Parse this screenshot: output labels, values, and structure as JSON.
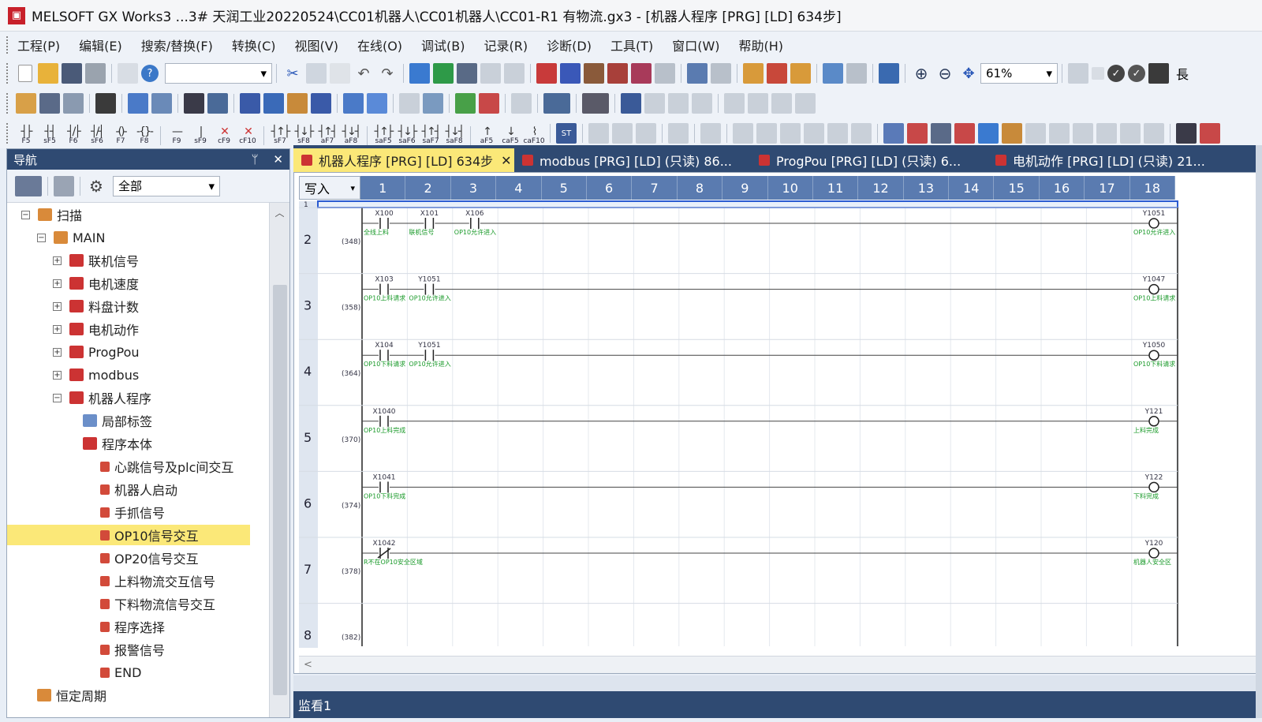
{
  "title": "MELSOFT GX Works3 ...3# 天润工业20220524\\CC01机器人\\CC01机器人\\CC01-R1 有物流.gx3 - [机器人程序 [PRG] [LD] 634步]",
  "menu": [
    "工程(P)",
    "编辑(E)",
    "搜索/替换(F)",
    "转换(C)",
    "视图(V)",
    "在线(O)",
    "调试(B)",
    "记录(R)",
    "诊断(D)",
    "工具(T)",
    "窗口(W)",
    "帮助(H)"
  ],
  "toolbar": {
    "zoom": "61%",
    "last_char": "長"
  },
  "fkeys": [
    {
      "sym": "┤├",
      "label": "F5"
    },
    {
      "sym": "┤┤",
      "label": "sF5"
    },
    {
      "sym": "┤/├",
      "label": "F6"
    },
    {
      "sym": "┤/┤",
      "label": "sF6"
    },
    {
      "sym": "-()-",
      "label": "F7"
    },
    {
      "sym": "-{}-",
      "label": "F8"
    },
    {
      "sym": "—",
      "label": "F9"
    },
    {
      "sym": "|",
      "label": "sF9"
    },
    {
      "sym": "✕",
      "label": "cF9"
    },
    {
      "sym": "✕",
      "label": "cF10"
    },
    {
      "sym": "┤↑├",
      "label": "sF7"
    },
    {
      "sym": "┤↓├",
      "label": "sF8"
    },
    {
      "sym": "┤↑┤",
      "label": "aF7"
    },
    {
      "sym": "┤↓┤",
      "label": "aF8"
    },
    {
      "sym": "┤↑├",
      "label": "saF5"
    },
    {
      "sym": "┤↓├",
      "label": "saF6"
    },
    {
      "sym": "┤↑┤",
      "label": "saF7"
    },
    {
      "sym": "┤↓┤",
      "label": "saF8"
    },
    {
      "sym": "↑",
      "label": "aF5"
    },
    {
      "sym": "↓",
      "label": "caF5"
    },
    {
      "sym": "⌇",
      "label": "caF10"
    }
  ],
  "nav": {
    "title": "导航",
    "pin": "ᛘ",
    "close": "✕",
    "filter": "全部",
    "tree": [
      {
        "label": "扫描",
        "level": 0,
        "exp": "−",
        "icon": "folder"
      },
      {
        "label": "MAIN",
        "level": 1,
        "exp": "−",
        "icon": "folder"
      },
      {
        "label": "联机信号",
        "level": 2,
        "exp": "+",
        "icon": "prog"
      },
      {
        "label": "电机速度",
        "level": 2,
        "exp": "+",
        "icon": "prog"
      },
      {
        "label": "料盘计数",
        "level": 2,
        "exp": "+",
        "icon": "prog"
      },
      {
        "label": "电机动作",
        "level": 2,
        "exp": "+",
        "icon": "prog"
      },
      {
        "label": "ProgPou",
        "level": 2,
        "exp": "+",
        "icon": "prog"
      },
      {
        "label": "modbus",
        "level": 2,
        "exp": "+",
        "icon": "prog"
      },
      {
        "label": "机器人程序",
        "level": 2,
        "exp": "−",
        "icon": "prog"
      },
      {
        "label": "局部标签",
        "level": 3,
        "exp": "",
        "icon": "label"
      },
      {
        "label": "程序本体",
        "level": 3,
        "exp": "",
        "icon": "prog"
      },
      {
        "label": "心跳信号及plc间交互",
        "level": 4,
        "exp": "",
        "icon": "small"
      },
      {
        "label": "机器人启动",
        "level": 4,
        "exp": "",
        "icon": "small"
      },
      {
        "label": "手抓信号",
        "level": 4,
        "exp": "",
        "icon": "small"
      },
      {
        "label": "OP10信号交互",
        "level": 4,
        "exp": "",
        "icon": "small",
        "selected": true
      },
      {
        "label": "OP20信号交互",
        "level": 4,
        "exp": "",
        "icon": "small"
      },
      {
        "label": "上料物流交互信号",
        "level": 4,
        "exp": "",
        "icon": "small"
      },
      {
        "label": "下料物流信号交互",
        "level": 4,
        "exp": "",
        "icon": "small"
      },
      {
        "label": "程序选择",
        "level": 4,
        "exp": "",
        "icon": "small"
      },
      {
        "label": "报警信号",
        "level": 4,
        "exp": "",
        "icon": "small"
      },
      {
        "label": "END",
        "level": 4,
        "exp": "",
        "icon": "small"
      },
      {
        "label": "恒定周期",
        "level": 1,
        "exp": "",
        "icon": "folder"
      }
    ]
  },
  "tabs": [
    {
      "label": "机器人程序 [PRG] [LD] 634步",
      "active": true,
      "close": "✕"
    },
    {
      "label": "modbus [PRG] [LD] (只读) 86...",
      "active": false
    },
    {
      "label": "ProgPou [PRG] [LD] (只读) 6...",
      "active": false
    },
    {
      "label": "电机动作 [PRG] [LD] (只读) 21...",
      "active": false
    }
  ],
  "editor": {
    "mode": "写入",
    "columns": [
      "1",
      "2",
      "3",
      "4",
      "5",
      "6",
      "7",
      "8",
      "9",
      "10",
      "11",
      "12",
      "13",
      "14",
      "15",
      "16",
      "17",
      "18"
    ],
    "first_row": "1",
    "rungs": [
      {
        "row": "2",
        "step": "(348)",
        "contacts": [
          {
            "dev": "X100",
            "col": 1,
            "note": "全线上料"
          },
          {
            "dev": "X101",
            "col": 2,
            "note": "联机信号"
          },
          {
            "dev": "X106",
            "col": 3,
            "note": "OP10允许进入"
          }
        ],
        "coil": {
          "dev": "Y1051",
          "note": "OP10允许进入"
        }
      },
      {
        "row": "3",
        "step": "(358)",
        "contacts": [
          {
            "dev": "X103",
            "col": 1,
            "note": "OP10上料请求"
          },
          {
            "dev": "Y1051",
            "col": 2,
            "note": "OP10允许进入"
          }
        ],
        "coil": {
          "dev": "Y1047",
          "note": "OP10上料请求"
        }
      },
      {
        "row": "4",
        "step": "(364)",
        "contacts": [
          {
            "dev": "X104",
            "col": 1,
            "note": "OP10下料请求"
          },
          {
            "dev": "Y1051",
            "col": 2,
            "note": "OP10允许进入"
          }
        ],
        "coil": {
          "dev": "Y1050",
          "note": "OP10下料请求"
        }
      },
      {
        "row": "5",
        "step": "(370)",
        "contacts": [
          {
            "dev": "X1040",
            "col": 1,
            "note": "OP10上料完成"
          }
        ],
        "coil": {
          "dev": "Y121",
          "note": "上料完成"
        }
      },
      {
        "row": "6",
        "step": "(374)",
        "contacts": [
          {
            "dev": "X1041",
            "col": 1,
            "note": "OP10下料完成"
          }
        ],
        "coil": {
          "dev": "Y122",
          "note": "下料完成"
        }
      },
      {
        "row": "7",
        "step": "(378)",
        "contacts": [
          {
            "dev": "X1042",
            "col": 1,
            "note": "R不在OP10安全区域",
            "nc": true
          }
        ],
        "coil": {
          "dev": "Y120",
          "note": "机器人安全区"
        }
      },
      {
        "row": "8",
        "step": "(382)",
        "contacts": [],
        "coil": null
      }
    ],
    "scroll_arrow": "<"
  },
  "watch": "监看1",
  "colors": {
    "accent": "#2f4a72",
    "selected": "#fbe878",
    "ladder_green": "#1a9a2a"
  }
}
